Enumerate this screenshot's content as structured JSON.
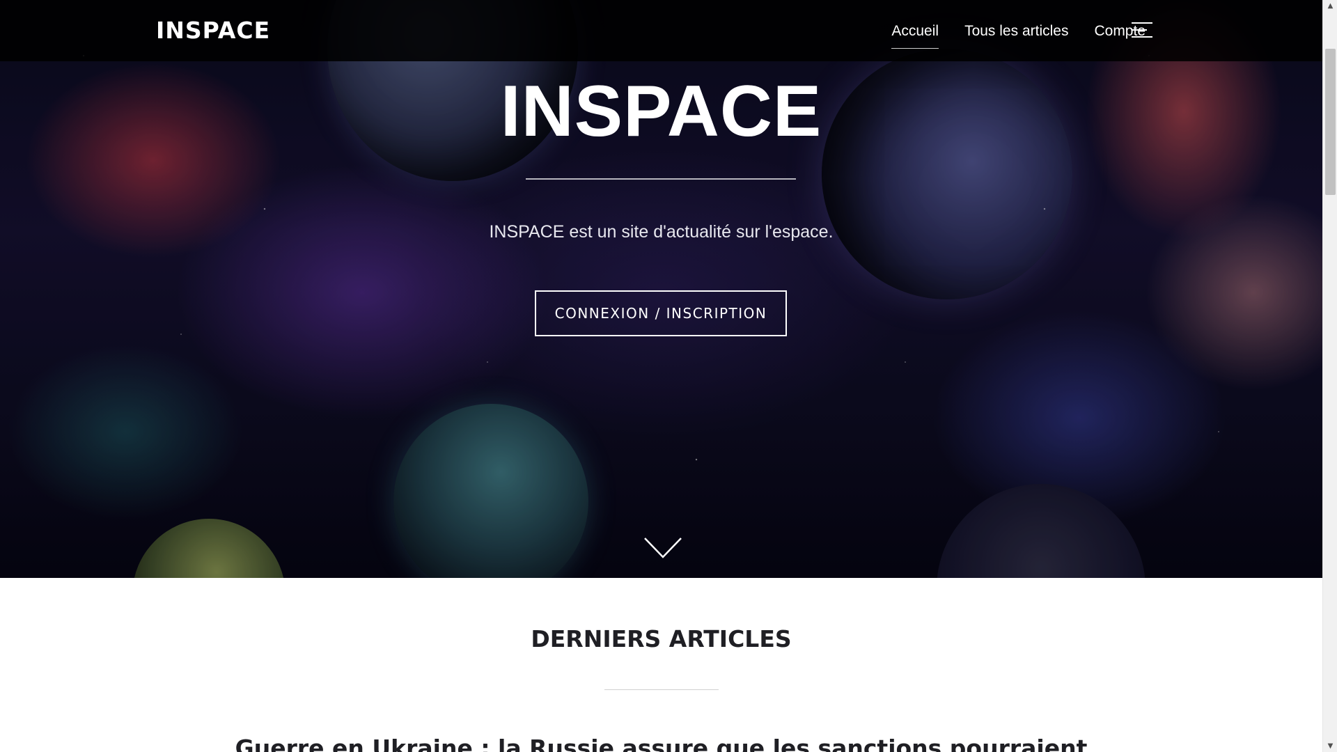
{
  "header": {
    "brand": "INSPACE",
    "nav": [
      {
        "label": "Accueil",
        "active": true
      },
      {
        "label": "Tous les articles",
        "active": false
      },
      {
        "label": "Compte",
        "active": false
      }
    ],
    "menu_icon": "hamburger-menu-icon"
  },
  "hero": {
    "title": "INSPACE",
    "subtitle": "INSPACE est un site d'actualité sur l'espace.",
    "cta_label": "CONNEXION / INSCRIPTION",
    "scroll_icon": "chevron-down-icon"
  },
  "latest": {
    "title": "DERNIERS ARTICLES",
    "first_article_title": "Guerre en Ukraine : la Russie assure que les sanctions pourraient"
  },
  "colors": {
    "navbar_bg": "#000000",
    "text_light": "#ffffff",
    "text_dark": "#1f1f24",
    "scrollbar_thumb": "#c1c1c1"
  }
}
